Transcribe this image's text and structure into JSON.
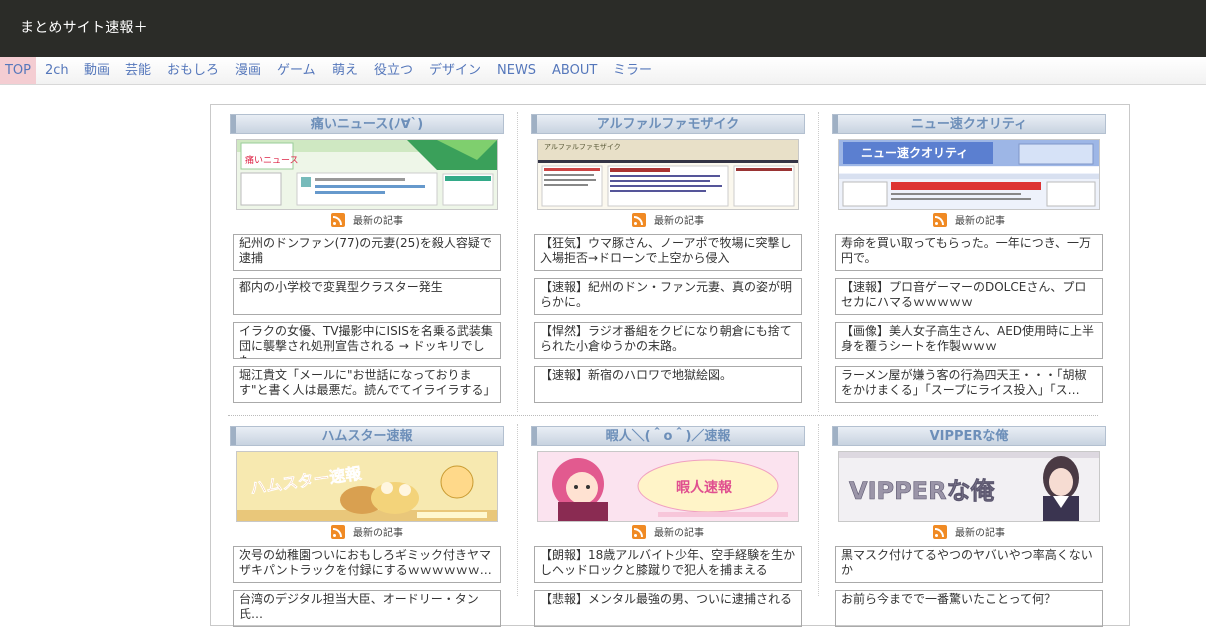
{
  "site_title": "まとめサイト速報＋",
  "nav": [
    "TOP",
    "2ch",
    "動画",
    "芸能",
    "おもしろ",
    "漫画",
    "ゲーム",
    "萌え",
    "役立つ",
    "デザイン",
    "NEWS",
    "ABOUT",
    "ミラー"
  ],
  "latest_label": "最新の記事",
  "colors": {
    "topbar": "#2b2c28",
    "nav_text": "#5577bb",
    "nav_active_bg": "#f4cdd2",
    "header_text": "#6d8fb9",
    "rss": "#f08a24"
  },
  "sites": [
    {
      "name": "痛いニュース(ﾉ∀`)",
      "thumb_text": "痛いニュース",
      "articles": [
        "紀州のドンファン(77)の元妻(25)を殺人容疑で逮捕",
        "都内の小学校で変異型クラスター発生",
        "イラクの女優、TV撮影中にISISを名乗る武装集団に襲撃され処刑宣告される → ドッキリでした",
        "堀江貴文「メールに\"お世話になっておりま す\"と書く人は最悪だ。読んでてイライラする」"
      ]
    },
    {
      "name": "アルファルファモザイク",
      "thumb_text": "アルファルファモザイク",
      "articles": [
        "【狂気】ウマ豚さん、ノーアポで牧場に突撃し入場拒否→ドローンで上空から侵入",
        "【速報】紀州のドン・ファン元妻、真の姿が明らかに。",
        "【悍然】ラジオ番組をクビになり朝倉にも捨てられた小倉ゆうかの末路。",
        "【速報】新宿のハロワで地獄絵図。"
      ]
    },
    {
      "name": "ニュー速クオリティ",
      "thumb_text": "ニュー速クオリティ",
      "articles": [
        "寿命を買い取ってもらった。一年につき、一万円で。",
        "【速報】プロ音ゲーマーのDOLCEさん、プロセカにハマるｗｗｗｗｗ",
        "【画像】美人女子高生さん、AED使用時に上半身を覆うシートを作製ｗｗｗ",
        "ラーメン屋が嫌う客の行為四天王・・・「胡椒をかけまくる」「スープにライス投入」「ス…"
      ]
    },
    {
      "name": "ハムスター速報",
      "thumb_text": "ハムスター速報",
      "articles": [
        "次号の幼稚園ついにおもしろギミック付きヤマザキパントラックを付録にするｗｗｗｗｗｗ…",
        "台湾のデジタル担当大臣、オードリー・タン氏…"
      ]
    },
    {
      "name": "暇人＼(＾o＾)／速報",
      "thumb_text": "暇人速報",
      "articles": [
        "【朗報】18歳アルバイト少年、空手経験を生かしヘッドロックと膝蹴りで犯人を捕まえる",
        "【悲報】メンタル最強の男、ついに逮捕される"
      ]
    },
    {
      "name": "VIPPERな俺",
      "thumb_text": "VIPPERな俺",
      "articles": [
        "黒マスク付けてるやつのヤバいやつ率高くないか",
        "お前ら今までで一番驚いたことって何？"
      ]
    }
  ]
}
